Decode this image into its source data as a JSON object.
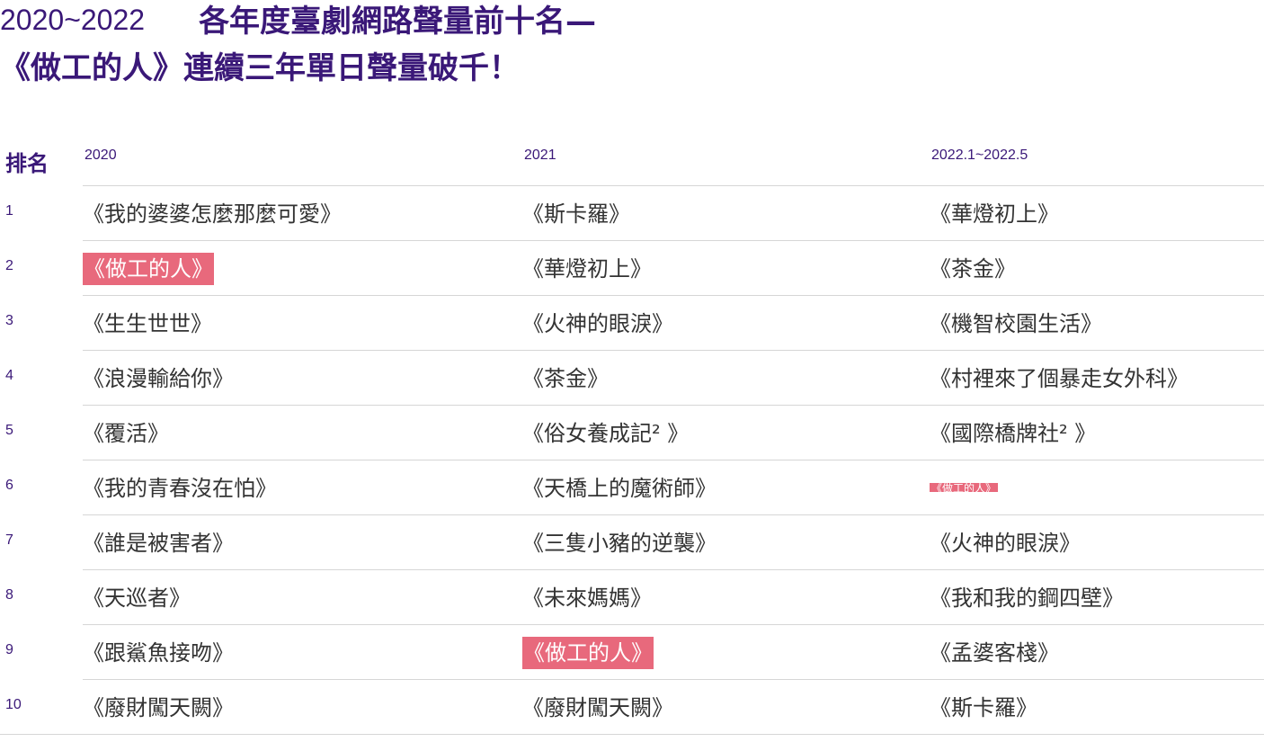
{
  "title": {
    "years": "2020~2022",
    "line1": "各年度臺劇網路聲量前十名—",
    "line2": "《做工的人》連續三年單日聲量破千！"
  },
  "header": {
    "rank": "排名",
    "columns": [
      "2020",
      "2021",
      "2022.1~2022.5"
    ]
  },
  "rows": [
    {
      "rank": "1",
      "c1": "《我的婆婆怎麼那麼可愛》",
      "c2": "《斯卡羅》",
      "c3": "《華燈初上》"
    },
    {
      "rank": "2",
      "c1": "《做工的人》",
      "c2": "《華燈初上》",
      "c3": "《茶金》"
    },
    {
      "rank": "3",
      "c1": "《生生世世》",
      "c2": "《火神的眼淚》",
      "c3": "《機智校園生活》"
    },
    {
      "rank": "4",
      "c1": "《浪漫輸給你》",
      "c2": "《茶金》",
      "c3": "《村裡來了個暴走女外科》"
    },
    {
      "rank": "5",
      "c1": "《覆活》",
      "c2": "《俗女養成記² 》",
      "c3": "《國際橋牌社² 》"
    },
    {
      "rank": "6",
      "c1": "《我的青春沒在怕》",
      "c2": "《天橋上的魔術師》",
      "c3": "《做工的人》"
    },
    {
      "rank": "7",
      "c1": "《誰是被害者》",
      "c2": "《三隻小豬的逆襲》",
      "c3": "《火神的眼淚》"
    },
    {
      "rank": "8",
      "c1": "《天巡者》",
      "c2": "《未來媽媽》",
      "c3": "《我和我的鋼四壁》"
    },
    {
      "rank": "9",
      "c1": "《跟鯊魚接吻》",
      "c2": "《做工的人》",
      "c3": "《孟婆客棧》"
    },
    {
      "rank": "10",
      "c1": "《廢財闖天闕》",
      "c2": "《廢財闖天闕》",
      "c3": "《斯卡羅》"
    }
  ],
  "colors": {
    "title": "#3a1878",
    "highlight": "#e8697c",
    "rule": "#d6d6d6",
    "text": "#333333"
  }
}
